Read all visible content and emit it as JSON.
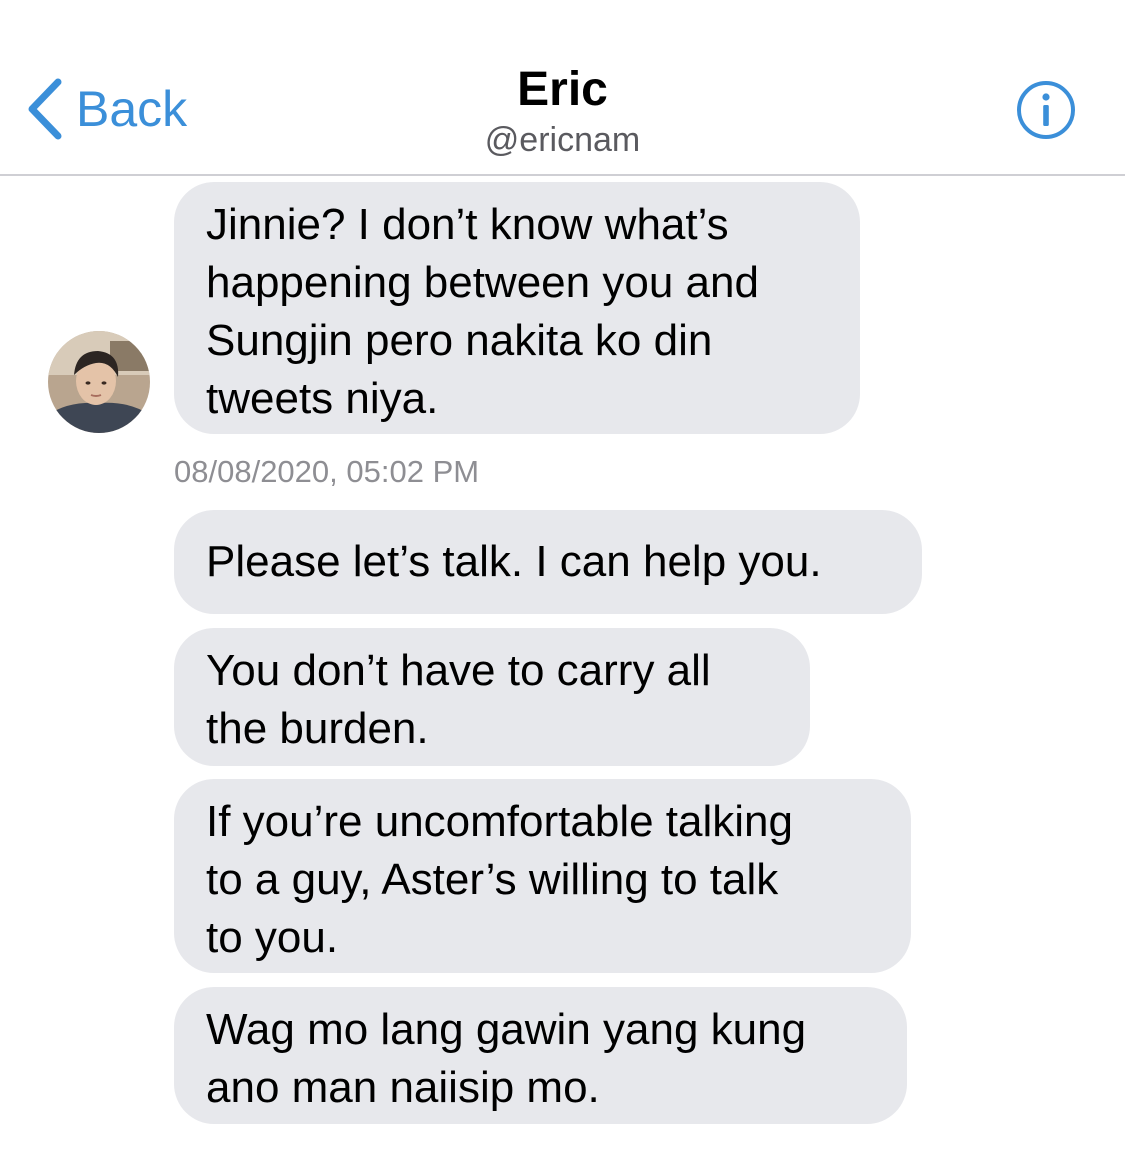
{
  "header": {
    "back_label": "Back",
    "title": "Eric",
    "handle": "@ericnam",
    "back_icon": "chevron-left-icon",
    "info_icon": "info-circle-icon"
  },
  "colors": {
    "accent": "#3b8fd9",
    "bubble": "#e7e8ec",
    "timestamp": "#8e8e93",
    "divider": "#cfcfd4"
  },
  "messages": [
    {
      "text": "Jinnie? I don’t know what’s\nhappening between you and\nSungjin pero nakita ko din\ntweets niya."
    },
    {
      "text": "Please let’s talk. I can help you."
    },
    {
      "text": "You don’t have to carry all\nthe burden."
    },
    {
      "text": "If you’re uncomfortable talking\nto a guy, Aster’s willing to talk\nto you."
    },
    {
      "text": "Wag mo lang gawin yang kung\nano man naiisip mo."
    }
  ],
  "timestamp": "08/08/2020, 05:02 PM"
}
